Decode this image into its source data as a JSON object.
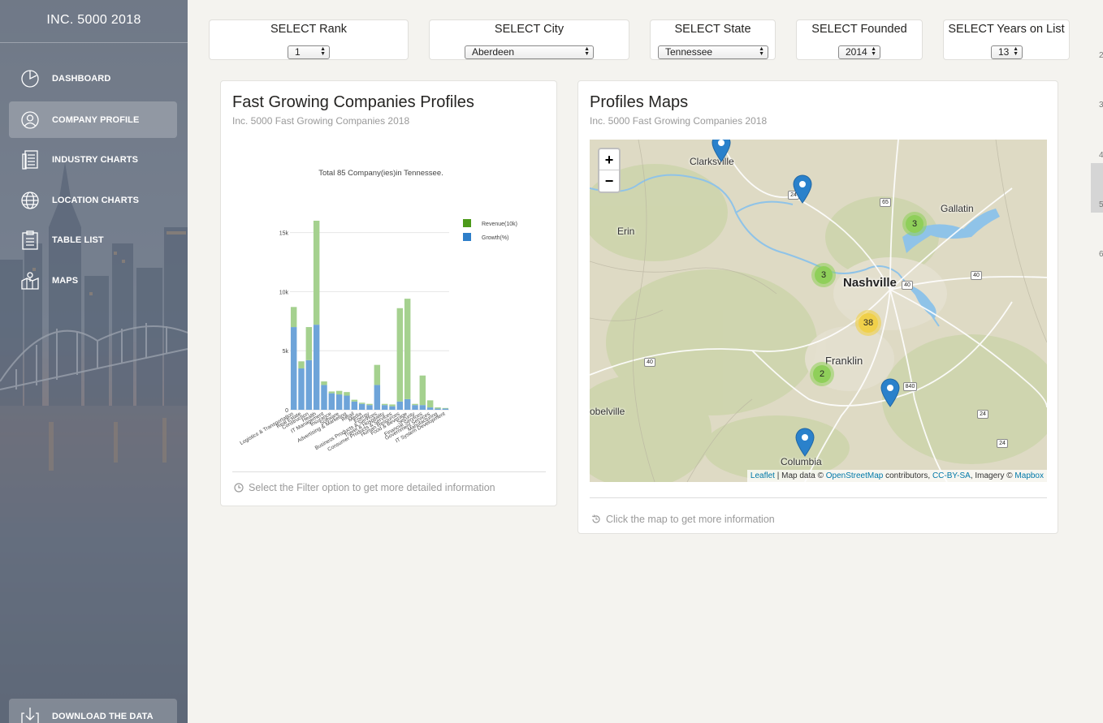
{
  "sidebar": {
    "title": "INC. 5000 2018",
    "items": [
      {
        "label": "DASHBOARD",
        "icon": "dashboard-icon"
      },
      {
        "label": "COMPANY PROFILE",
        "icon": "user-circle-icon",
        "active": true
      },
      {
        "label": "INDUSTRY CHARTS",
        "icon": "document-list-icon"
      },
      {
        "label": "LOCATION CHARTS",
        "icon": "globe-icon"
      },
      {
        "label": "TABLE LIST",
        "icon": "clipboard-list-icon"
      },
      {
        "label": "MAPS",
        "icon": "map-icon"
      }
    ],
    "download": {
      "label": "DOWNLOAD THE DATA",
      "icon": "download-icon"
    }
  },
  "filters": [
    {
      "label": "SELECT Rank",
      "value": "1"
    },
    {
      "label": "SELECT City",
      "value": "Aberdeen"
    },
    {
      "label": "SELECT State",
      "value": "Tennessee"
    },
    {
      "label": "SELECT Founded",
      "value": "2014"
    },
    {
      "label": "SELECT Years on List",
      "value": "13"
    }
  ],
  "profiles_card": {
    "title": "Fast Growing Companies Profiles",
    "subtitle": "Inc. 5000 Fast Growing Companies 2018",
    "footer": "Select the Filter option to get more detailed information"
  },
  "maps_card": {
    "title": "Profiles Maps",
    "subtitle": "Inc. 5000 Fast Growing Companies 2018",
    "footer": "Click the map to get more information"
  },
  "map": {
    "zoom_in": "+",
    "zoom_out": "−",
    "places": [
      "Clarksville",
      "Gallatin",
      "Erin",
      "Nashville",
      "Franklin",
      "Columbia",
      "obelville"
    ],
    "highway_shields": [
      "24",
      "65",
      "40",
      "40",
      "40",
      "840",
      "24",
      "24"
    ],
    "clusters": [
      {
        "count": "3",
        "level": "small"
      },
      {
        "count": "3",
        "level": "small"
      },
      {
        "count": "38",
        "level": "medium"
      },
      {
        "count": "2",
        "level": "small"
      }
    ],
    "attribution": {
      "leaflet": "Leaflet",
      "sep": " | Map data © ",
      "osm": "OpenStreetMap",
      "contrib": " contributors, ",
      "license": "CC-BY-SA",
      "imagery": ", Imagery © ",
      "provider": "Mapbox"
    },
    "colors": {
      "water": "#8fc3e8",
      "cluster_small": "#8fcf5a",
      "cluster_medium": "#f0d04a",
      "marker": "#2a81cb"
    }
  },
  "chart_data": {
    "type": "bar",
    "stacked": true,
    "title": "Total 85 Company(ies)in Tennessee.",
    "xlabel": "",
    "ylabel": "",
    "ylim": [
      0,
      16000
    ],
    "yticks": [
      0,
      5000,
      10000,
      15000
    ],
    "ytick_labels": [
      "0",
      "5k",
      "10k",
      "15k"
    ],
    "legend_position": "top-right",
    "categories": [
      "Logistics & Transportation",
      "Real Estate",
      "Construction",
      "Health",
      "IT Management",
      "Insurance",
      "Software",
      "Advertising & Marketing",
      "Retail",
      "Media",
      "Energy",
      "Business Products & Services",
      "Travel & Hospitality",
      "Consumer Products & Services",
      "Human Resources",
      "Food & Beverage",
      "Security",
      "Financial Services",
      "Government Services",
      "Manufacturing",
      "IT System Development"
    ],
    "series": [
      {
        "name": "Revenue(10k)",
        "color": "#a5d18f",
        "values": [
          1700,
          600,
          2800,
          8800,
          300,
          150,
          300,
          300,
          150,
          100,
          100,
          1700,
          100,
          150,
          7900,
          8500,
          100,
          2500,
          600,
          100,
          50
        ]
      },
      {
        "name": "Growth(%)",
        "color": "#6ea4d9",
        "values": [
          7000,
          3500,
          4200,
          7200,
          2100,
          1400,
          1300,
          1200,
          700,
          500,
          400,
          2100,
          400,
          300,
          700,
          900,
          400,
          400,
          200,
          100,
          100
        ]
      }
    ],
    "legend_marker_colors": [
      "#4c9a1a",
      "#2e7ec9"
    ],
    "tick_label_color": "#444444",
    "gridline_color": "#e6e6e6"
  },
  "right_edge_digits": [
    "2",
    "3",
    "4",
    "5",
    "6"
  ]
}
